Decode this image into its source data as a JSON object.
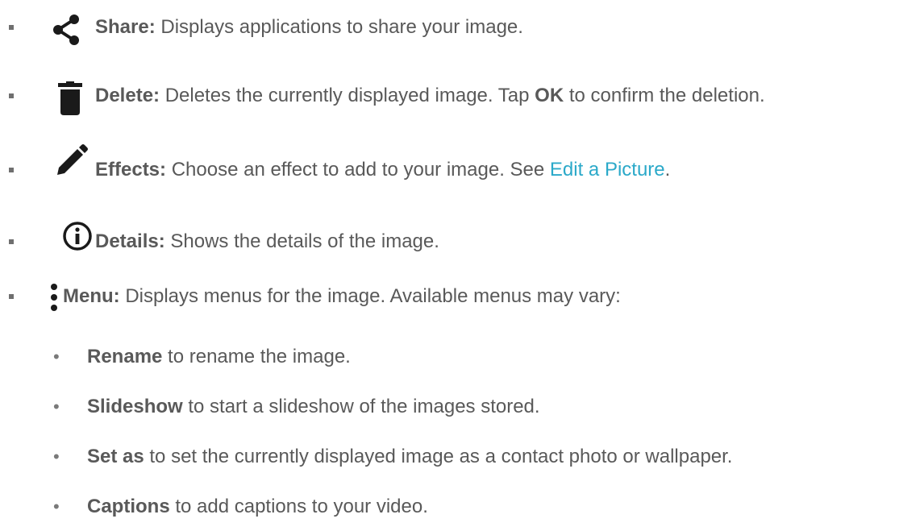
{
  "items": [
    {
      "icon": "share-icon",
      "label": "Share:",
      "text": " Displays applications to share your image."
    },
    {
      "icon": "trash-icon",
      "label": "Delete:",
      "text_before": " Deletes the currently displayed image. Tap ",
      "text_bold": "OK",
      "text_after": " to confirm the deletion."
    },
    {
      "icon": "pencil-icon",
      "label": "Effects:",
      "text": " Choose an effect to add to your image. See ",
      "link": "Edit a Picture",
      "text_after": "."
    },
    {
      "icon": "info-icon",
      "label": "Details:",
      "text": " Shows the details of the image."
    },
    {
      "icon": "more-vert-icon",
      "label": "Menu:",
      "text": " Displays menus for the image. Available menus may vary:"
    }
  ],
  "submenu": [
    {
      "label": "Rename",
      "text": " to rename the image."
    },
    {
      "label": "Slideshow",
      "text": " to start a slideshow of the images stored."
    },
    {
      "label": "Set as",
      "text": " to set the currently displayed image as a contact photo or wallpaper."
    },
    {
      "label": "Captions",
      "text": " to add captions to your video."
    }
  ],
  "colors": {
    "text": "#595959",
    "link": "#2ba9c9",
    "icon": "#1a1a1a"
  }
}
